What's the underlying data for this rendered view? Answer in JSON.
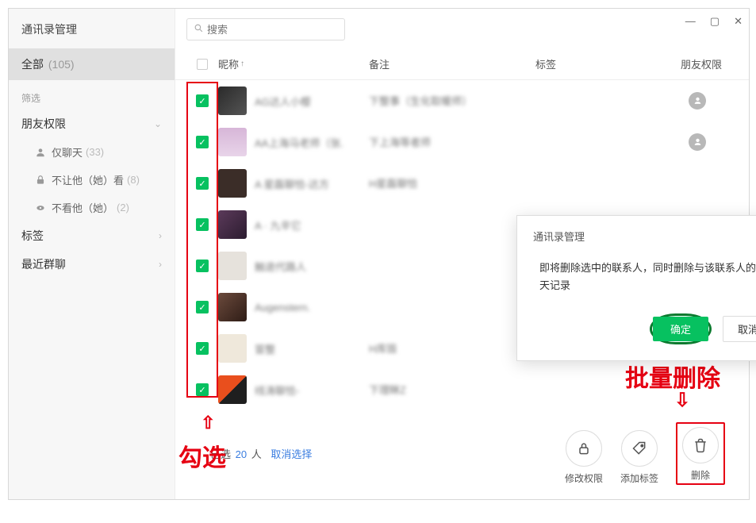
{
  "sidebar": {
    "title": "通讯录管理",
    "all_label": "全部",
    "all_count": "(105)",
    "filter_label": "筛选",
    "priv_label": "朋友权限",
    "sub_chat_label": "仅聊天",
    "sub_chat_count": "(33)",
    "sub_hide_from_label": "不让他（她）看",
    "sub_hide_from_count": "(8)",
    "sub_not_see_label": "不看他（她）",
    "sub_not_see_count": "(2)",
    "tag_label": "标签",
    "recent_label": "最近群聊"
  },
  "search": {
    "placeholder": "搜索"
  },
  "header": {
    "nick": "昵称",
    "remark": "备注",
    "tag": "标签",
    "priv": "朋友权限"
  },
  "rows": [
    {
      "nick": "AG达人小樱",
      "remark": "下整事（生化取暖师）",
      "priv": true
    },
    {
      "nick": "AA上海马老师（张.",
      "remark": "下上海等者师",
      "priv": true
    },
    {
      "nick": "A 星磊聊恰-达方",
      "remark": "H星磊聊恰",
      "priv": false
    },
    {
      "nick": "A · 九辛它",
      "remark": "",
      "priv": true
    },
    {
      "nick": "触途代路人",
      "remark": "",
      "priv": true
    },
    {
      "nick": "Augenstern.",
      "remark": "",
      "priv": false
    },
    {
      "nick": "冒整",
      "remark": "H库毁",
      "priv": false
    },
    {
      "nick": "线涛聊恰-",
      "remark": "下理眯Z",
      "priv": false
    }
  ],
  "modal": {
    "title": "通讯录管理",
    "body": "即将删除选中的联系人，同时删除与该联系人的聊天记录",
    "ok": "确定",
    "cancel": "取消"
  },
  "footer": {
    "selected_prefix": "已选",
    "selected_count": "20",
    "selected_suffix": "人",
    "deselect": "取消选择",
    "modify_priv": "修改权限",
    "add_tag": "添加标签",
    "delete": "删除"
  },
  "annot": {
    "check_label": "勾选",
    "delete_label": "批量删除"
  }
}
